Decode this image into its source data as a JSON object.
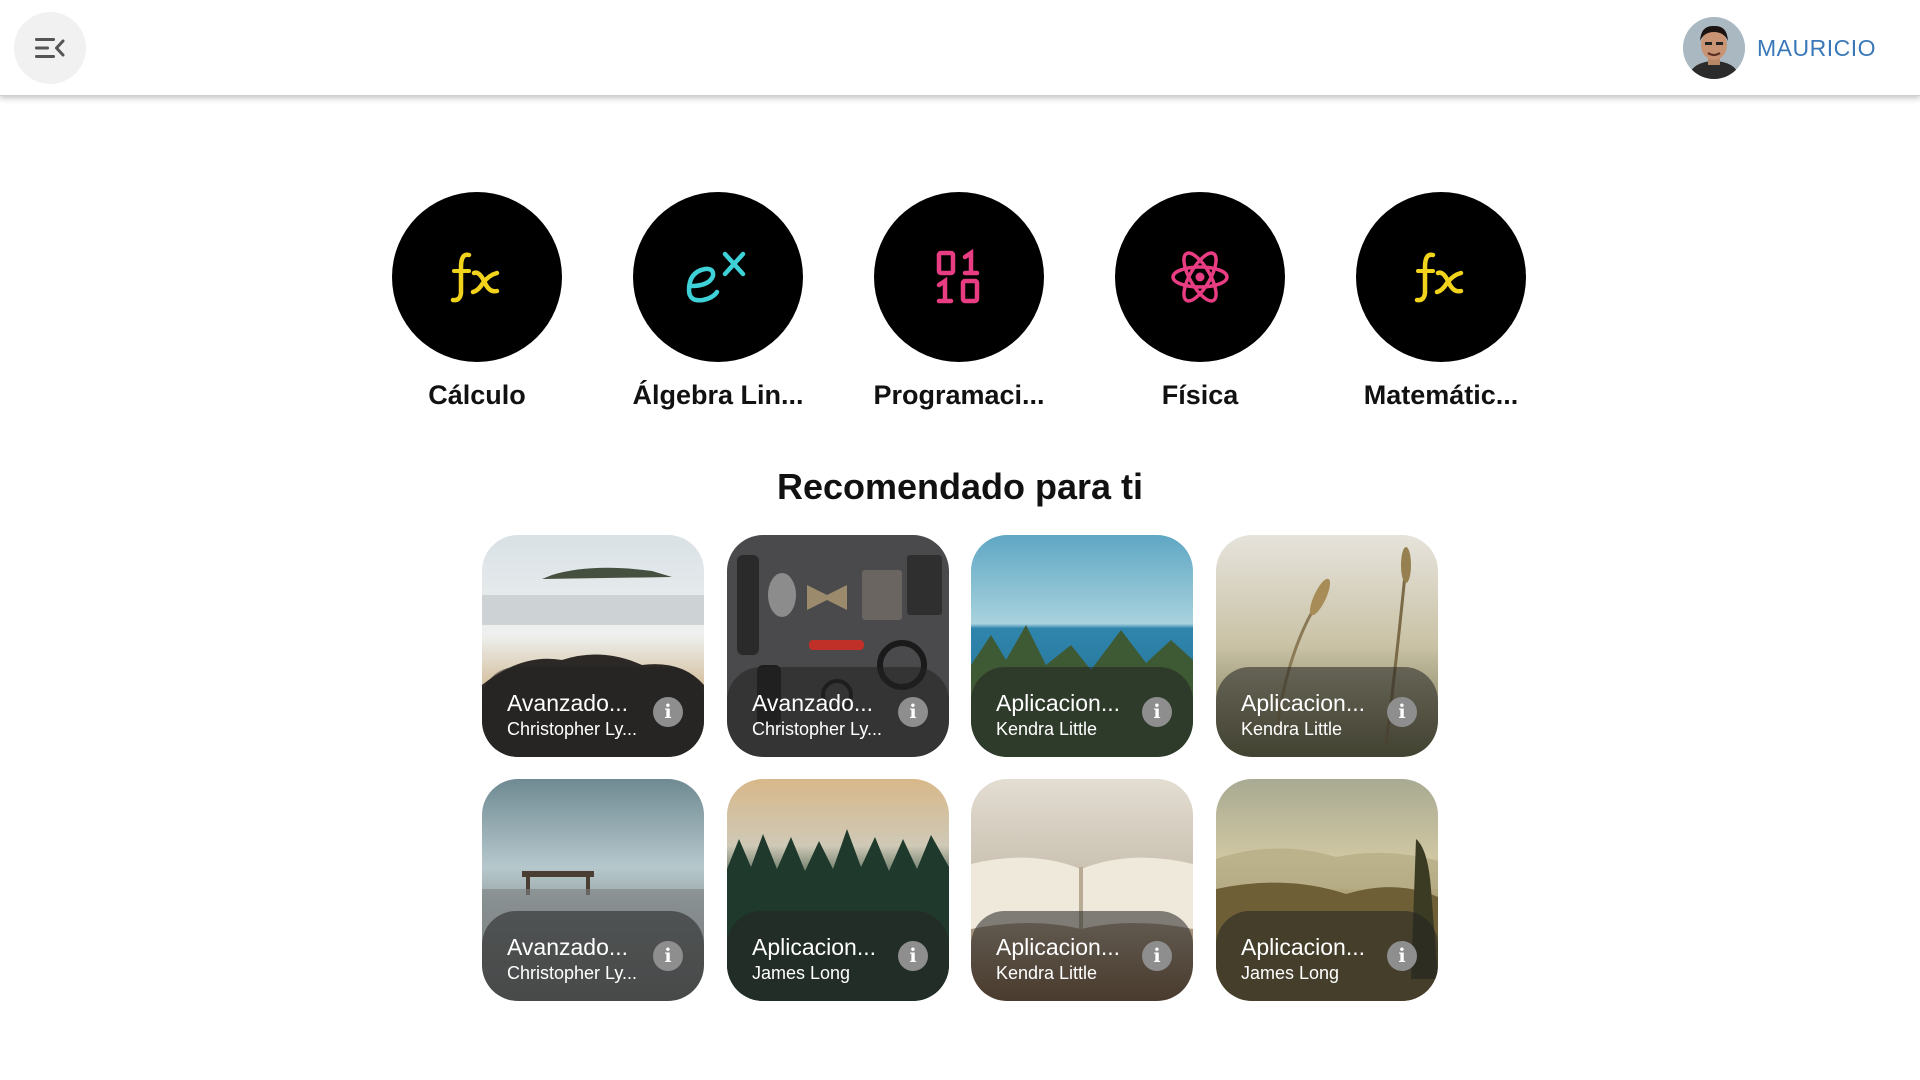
{
  "header": {
    "menu_icon": "menu-collapse-icon",
    "user_name": "MAURICIO"
  },
  "subjects": [
    {
      "label": "Cálculo",
      "icon": "function-fx-icon",
      "icon_color": "#f2d31c"
    },
    {
      "label": "Álgebra Lin...",
      "icon": "exponential-icon",
      "icon_color": "#3fd1d8"
    },
    {
      "label": "Programaci...",
      "icon": "binary-icon",
      "icon_color": "#e83d82"
    },
    {
      "label": "Física",
      "icon": "atom-icon",
      "icon_color": "#e83d82"
    },
    {
      "label": "Matemátic...",
      "icon": "function-fx-icon",
      "icon_color": "#f2d31c"
    }
  ],
  "recommended": {
    "title": "Recomendado para ti",
    "courses": [
      {
        "title": "Avanzado...",
        "author": "Christopher Ly..."
      },
      {
        "title": "Avanzado...",
        "author": "Christopher Ly..."
      },
      {
        "title": "Aplicacion...",
        "author": "Kendra Little"
      },
      {
        "title": "Aplicacion...",
        "author": "Kendra Little"
      },
      {
        "title": "Avanzado...",
        "author": "Christopher Ly..."
      },
      {
        "title": "Aplicacion...",
        "author": "James Long"
      },
      {
        "title": "Aplicacion...",
        "author": "Kendra Little"
      },
      {
        "title": "Aplicacion...",
        "author": "James Long"
      }
    ]
  },
  "colors": {
    "accent": "#3a78b8",
    "circle_bg": "#000000"
  }
}
